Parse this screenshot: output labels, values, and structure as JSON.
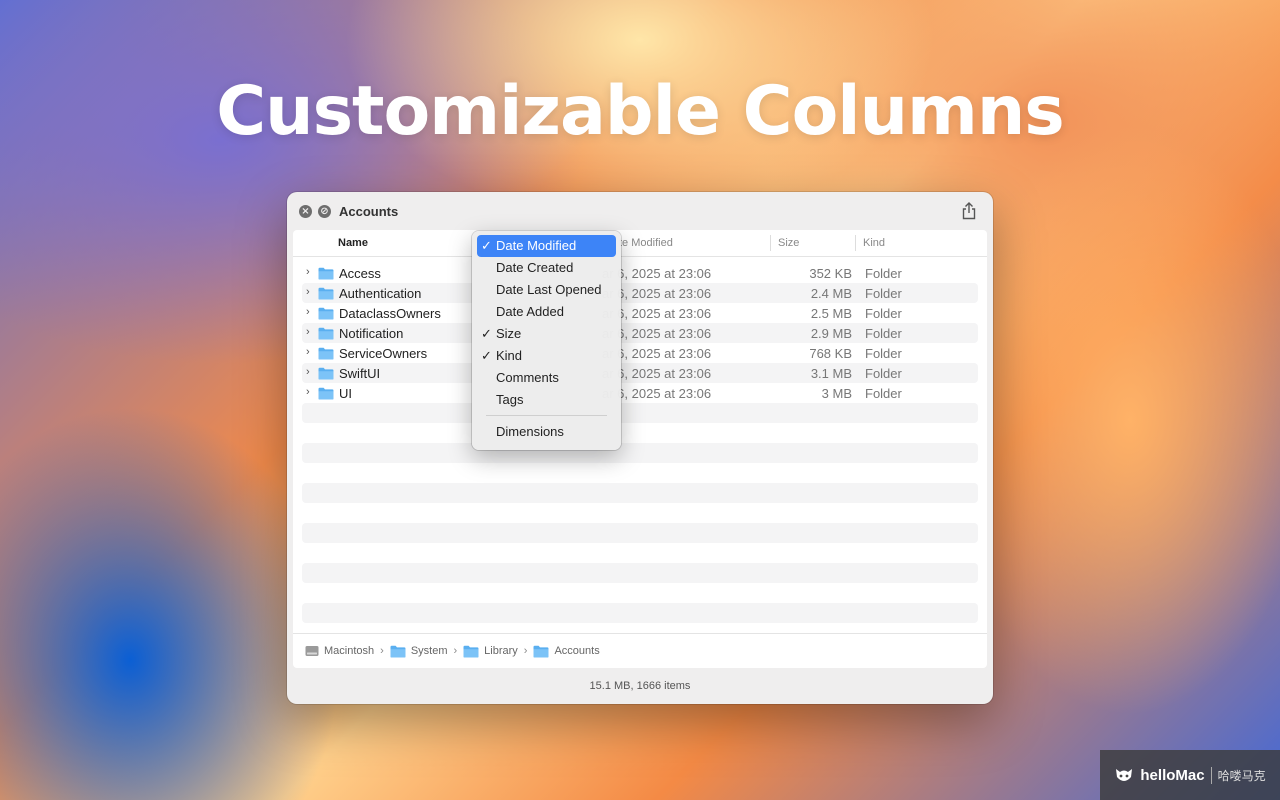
{
  "colors": {
    "accent": "#3d84f7",
    "folder_blue": "#5aaff0"
  },
  "hero": {
    "title": "Customizable Columns"
  },
  "window": {
    "title": "Accounts",
    "close_icon": "close-icon",
    "navigate_icon": "no-entry-icon",
    "share_icon": "share-icon"
  },
  "columns": {
    "name": "Name",
    "date_modified_partial": "te Modified",
    "size": "Size",
    "kind": "Kind"
  },
  "rows": [
    {
      "name": "Access",
      "date": "ar 6, 2025 at 23:06",
      "size": "352 KB",
      "kind": "Folder"
    },
    {
      "name": "Authentication",
      "date": "ar 6, 2025 at 23:06",
      "size": "2.4 MB",
      "kind": "Folder"
    },
    {
      "name": "DataclassOwners",
      "date": "ar 6, 2025 at 23:06",
      "size": "2.5 MB",
      "kind": "Folder"
    },
    {
      "name": "Notification",
      "date": "ar 6, 2025 at 23:06",
      "size": "2.9 MB",
      "kind": "Folder"
    },
    {
      "name": "ServiceOwners",
      "date": "ar 6, 2025 at 23:06",
      "size": "768 KB",
      "kind": "Folder"
    },
    {
      "name": "SwiftUI",
      "date": "ar 6, 2025 at 23:06",
      "size": "3.1 MB",
      "kind": "Folder"
    },
    {
      "name": "UI",
      "date": "ar 6, 2025 at 23:06",
      "size": "3 MB",
      "kind": "Folder"
    }
  ],
  "context_menu": {
    "items": [
      {
        "label": "Date Modified",
        "checked": true,
        "selected": true
      },
      {
        "label": "Date Created",
        "checked": false
      },
      {
        "label": "Date Last Opened",
        "checked": false
      },
      {
        "label": "Date Added",
        "checked": false
      },
      {
        "label": "Size",
        "checked": true
      },
      {
        "label": "Kind",
        "checked": true
      },
      {
        "label": "Comments",
        "checked": false
      },
      {
        "label": "Tags",
        "checked": false
      }
    ],
    "after_divider": {
      "label": "Dimensions",
      "checked": false
    },
    "check_mark": "✓"
  },
  "path_bar": {
    "segments": [
      "Macintosh",
      "System",
      "Library",
      "Accounts"
    ],
    "separator": "›"
  },
  "status": {
    "text": "15.1 MB, 1666 items"
  },
  "watermark": {
    "brand": "helloMac",
    "sub": "哈喽马克"
  }
}
